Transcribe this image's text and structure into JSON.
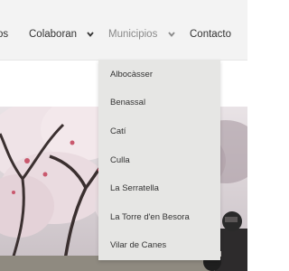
{
  "nav": {
    "items": [
      {
        "label": "os"
      },
      {
        "label": "Colaboran"
      },
      {
        "label": "Municipios"
      },
      {
        "label": "Contacto"
      }
    ],
    "chevron": "chevron-down-icon"
  },
  "dropdown": {
    "items": [
      {
        "label": "Albocàsser"
      },
      {
        "label": "Benassal"
      },
      {
        "label": "Catí"
      },
      {
        "label": "Culla"
      },
      {
        "label": "La Serratella"
      },
      {
        "label": "La Torre d'en Besora"
      },
      {
        "label": "Vilar de Canes"
      }
    ]
  },
  "hero": {
    "description": "Almond trees in blossom with a motorcyclist"
  }
}
